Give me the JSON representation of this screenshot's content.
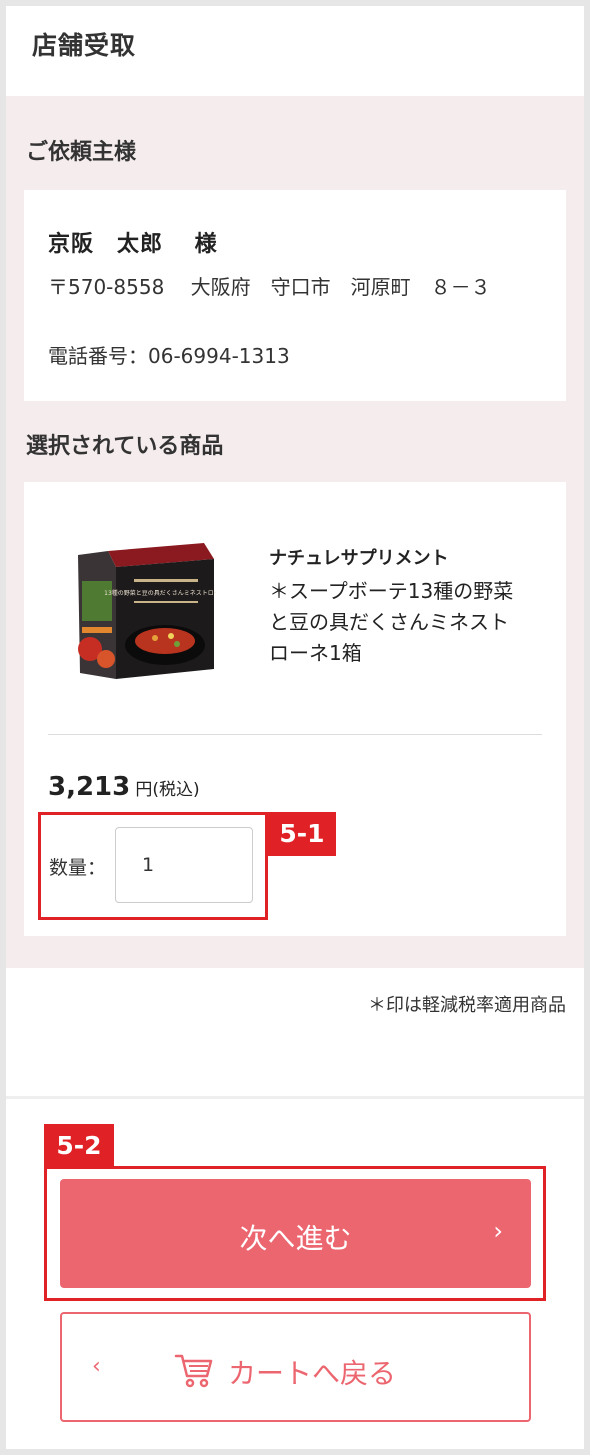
{
  "header": {
    "title": "店舗受取"
  },
  "client": {
    "section_title": "ご依頼主様",
    "name": "京阪　太郎　 様",
    "address": "〒570-8558　 大阪府　守口市　河原町　８－３",
    "tel": "電話番号：06-6994-1313"
  },
  "products": {
    "section_title": "選択されている商品",
    "item": {
      "brand": "ナチュレサプリメント",
      "name": "＊スープボーテ13種の野菜と豆の具だくさんミネストローネ1箱",
      "image_text": "13種の野菜と豆の具だくさんミネストローネ",
      "price_value": "3,213",
      "price_unit": "円(税込)",
      "quantity_label": "数量：",
      "quantity_value": "1"
    }
  },
  "badges": {
    "quantity": "5-1",
    "next": "5-2"
  },
  "note": "＊印は軽減税率適用商品",
  "buttons": {
    "next_label": "次へ進む",
    "next_chevron": "›",
    "back_label": "カートへ戻る",
    "back_chevron": "‹"
  },
  "colors": {
    "accent": "#ec6670",
    "highlight": "#e02226",
    "panel": "#f5eced"
  },
  "icons": {
    "cart": "cart-icon"
  }
}
